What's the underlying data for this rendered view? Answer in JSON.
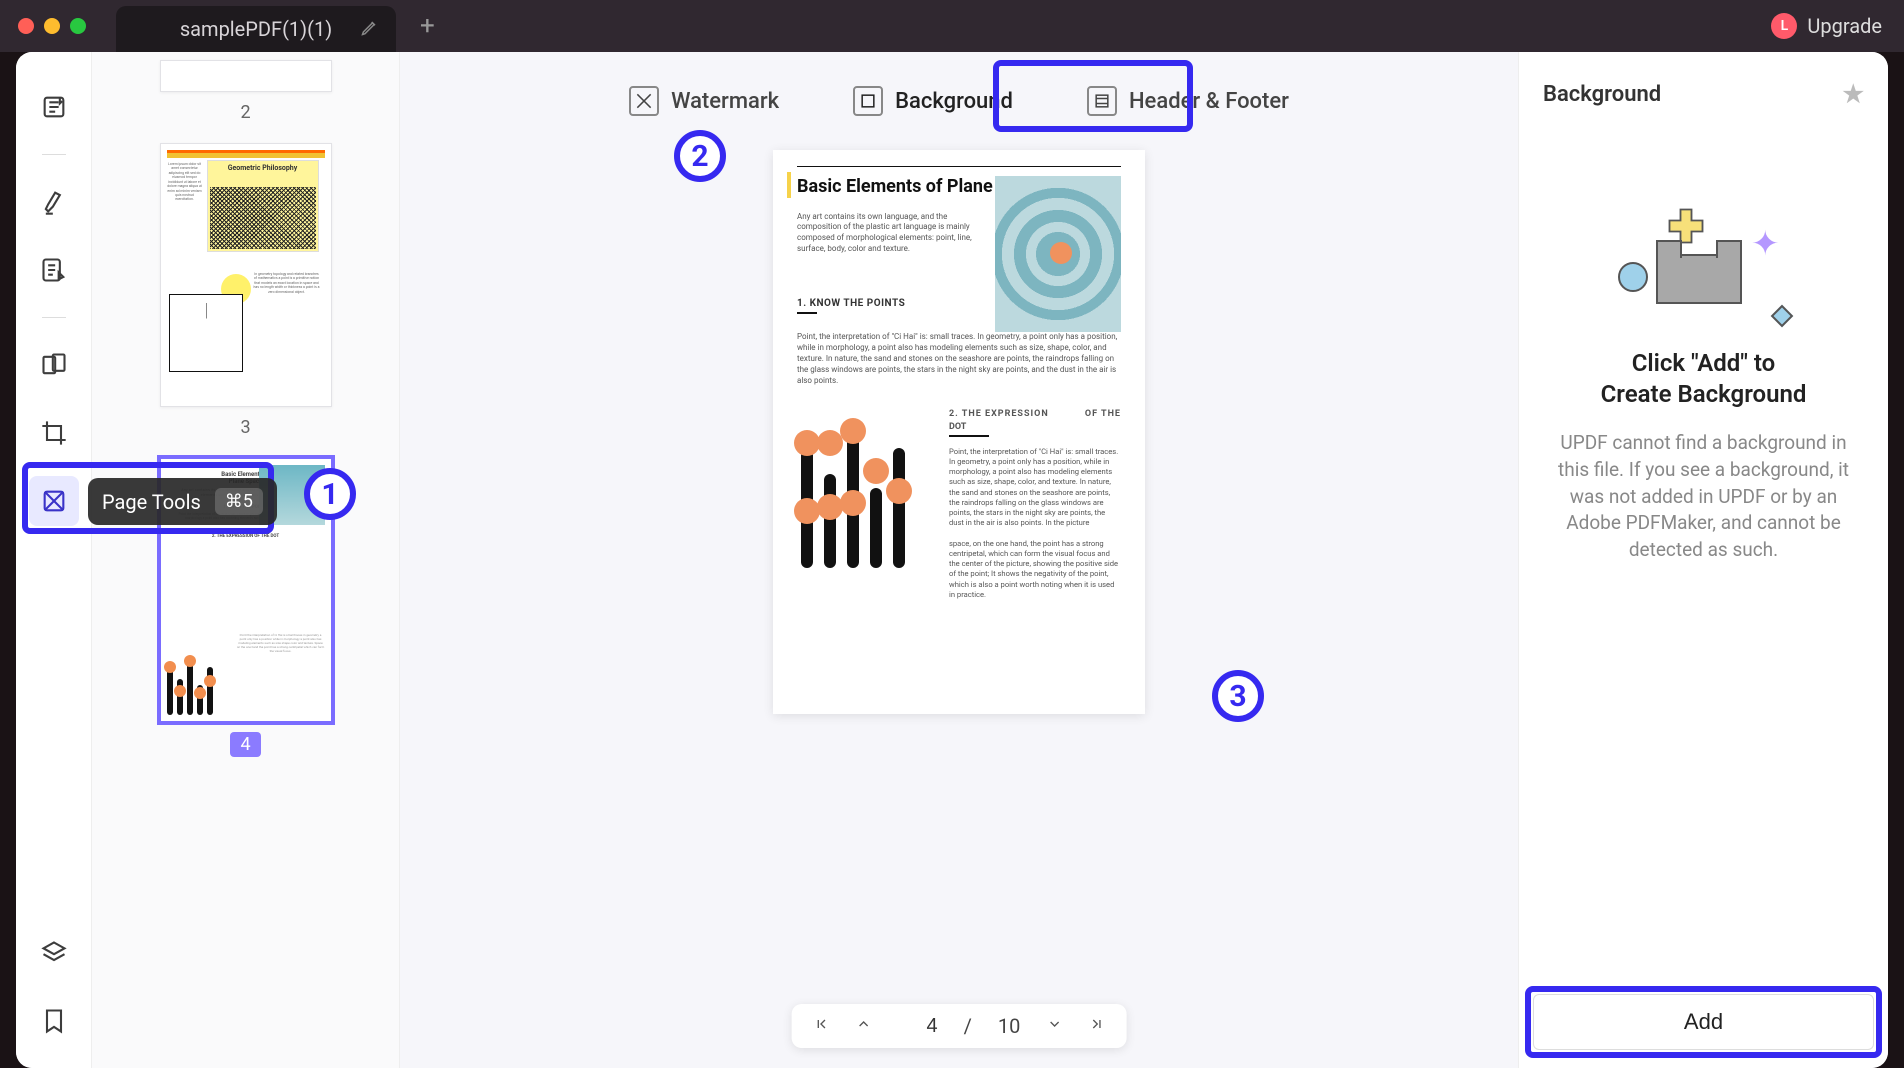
{
  "titlebar": {
    "tab_title": "samplePDF(1)(1)",
    "upgrade_initial": "L",
    "upgrade_label": "Upgrade"
  },
  "sidebar": {
    "tools": [
      {
        "name": "reader-tool"
      },
      {
        "name": "highlighter-tool"
      },
      {
        "name": "edit-text-tool"
      },
      {
        "name": "organize-pages-tool"
      },
      {
        "name": "crop-tool"
      },
      {
        "name": "page-tools-tool"
      }
    ],
    "tooltip_label": "Page Tools",
    "tooltip_shortcut": "⌘5",
    "bottom": [
      {
        "name": "layers-tool"
      },
      {
        "name": "bookmark-tool"
      }
    ]
  },
  "thumbnails": {
    "pages": [
      {
        "num": "2"
      },
      {
        "num": "3",
        "title": "Geometric Philosophy"
      },
      {
        "num": "4",
        "selected": true
      }
    ]
  },
  "topbar": {
    "items": [
      {
        "label": "Watermark",
        "name": "watermark"
      },
      {
        "label": "Background",
        "name": "background",
        "active": true
      },
      {
        "label": "Header & Footer",
        "name": "header-footer"
      }
    ]
  },
  "document": {
    "title": "Basic Elements of Plane Space",
    "lead": "Any art contains its own language, and the composition of the plastic art language is mainly composed of morphological elements: point, line, surface, body, color and texture.",
    "h1": "1. KNOW THE POINTS",
    "body1": "Point, the interpretation of \"Ci Hai\" is: small traces. In geometry, a point only has a position, while in morphology, a point also has modeling elements such as size, shape, color, and texture. In nature, the sand and stones on the seashore are points, the raindrops falling on the glass windows are points, the stars in the night sky are points, and the dust in the air is also points.",
    "h2_a": "2. THE EXPRESSION",
    "h2_b": "OF THE",
    "h2_c": "DOT",
    "body2": "Point, the interpretation of \"Ci Hai\" is: small traces. In geometry, a point only has a position, while in morphology, a point also has modeling elements such as size, shape, color, and texture. In nature, the sand and stones on the seashore are points, the raindrops falling on the glass windows are points, the stars in the night sky are points, the dust in the air is also points. In the picture",
    "body3": "space, on the one hand, the point has a strong centripetal, which can form the visual focus and the center of the picture, showing the positive side of the point; It shows the negativity of the point, which is also a point worth noting when it is used in practice."
  },
  "pager": {
    "current": "4",
    "total": "10",
    "sep": "/"
  },
  "rightpanel": {
    "header": "Background",
    "title_l1": "Click \"Add\" to",
    "title_l2": "Create Background",
    "description": "UPDF cannot find a background in this file. If you see a background, it was not added in UPDF or by an Adobe PDFMaker, and cannot be detected as such.",
    "add_label": "Add"
  },
  "callouts": {
    "n1": "1",
    "n2": "2",
    "n3": "3"
  }
}
